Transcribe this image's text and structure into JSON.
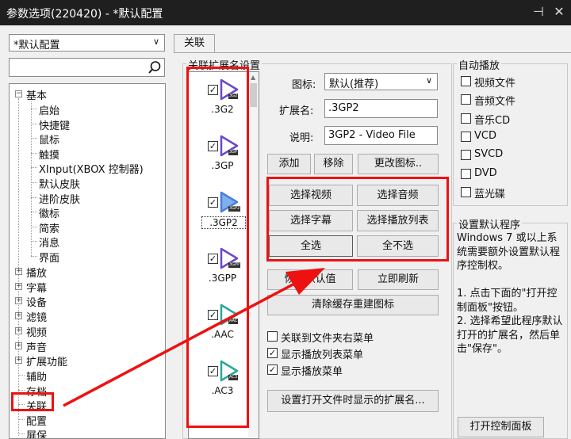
{
  "window": {
    "title": "参数选项(220420) - *默认配置"
  },
  "left": {
    "profile_select": "*默认配置",
    "search_placeholder": "",
    "tree": {
      "basic": "基本",
      "basic_children": [
        "启始",
        "快捷键",
        "鼠标",
        "触摸",
        "XInput(XBOX 控制器)",
        "默认皮肤",
        "进阶皮肤",
        "徽标",
        "简索",
        "消息",
        "界面"
      ],
      "top_items": [
        "播放",
        "字幕",
        "设备",
        "滤镜",
        "视频",
        "声音",
        "扩展功能"
      ],
      "plain_items": [
        "辅助",
        "存档",
        "关联",
        "配置",
        "屏保"
      ]
    }
  },
  "tab": {
    "label": "关联"
  },
  "ext_section": {
    "title": "关联扩展名设置",
    "items": [
      ".3G2",
      ".3GP",
      ".3GP2",
      ".3GPP",
      ".AAC",
      ".AC3"
    ],
    "badges": [
      "3G2",
      "3GP",
      "3GP2",
      "3GPP",
      "AAC",
      "AC3"
    ],
    "colors": [
      "#6d48c8",
      "#6d48c8",
      "#4a7fd6",
      "#6d48c8",
      "#2aa89a",
      "#2aa89a"
    ]
  },
  "form": {
    "icon_label": "图标:",
    "icon_value": "默认(推荐)",
    "ext_label": "扩展名:",
    "ext_value": ".3GP2",
    "desc_label": "说明:",
    "desc_value": "3GP2 - Video File",
    "add": "添加",
    "remove": "移除",
    "change_icon": "更改图标..",
    "select_video": "选择视频",
    "select_audio": "选择音频",
    "select_sub": "选择字幕",
    "select_playlist": "选择播放列表",
    "select_all": "全选",
    "select_none": "全不选",
    "restore": "恢复默认值",
    "refresh": "立即刷新",
    "rebuild": "清除缓存重建图标",
    "opt_folder_menu": "关联到文件夹右菜单",
    "opt_playlist_menu": "显示播放列表菜单",
    "opt_play_menu": "显示播放菜单",
    "set_open_ext": "设置打开文件时显示的扩展名..."
  },
  "autoplay": {
    "title": "自动播放",
    "items": [
      "视频文件",
      "音频文件",
      "音乐CD",
      "VCD",
      "SVCD",
      "DVD",
      "蓝光碟"
    ]
  },
  "default_program": {
    "title": "设置默认程序",
    "text": "Windows 7 或以上系统需要额外设置默认程序控制权。\n\n1. 点击下面的\"打开控制面板\"按钮。\n2. 选择希望此程序默认打开的扩展名，然后单击\"保存\"。",
    "button": "打开控制面板"
  }
}
